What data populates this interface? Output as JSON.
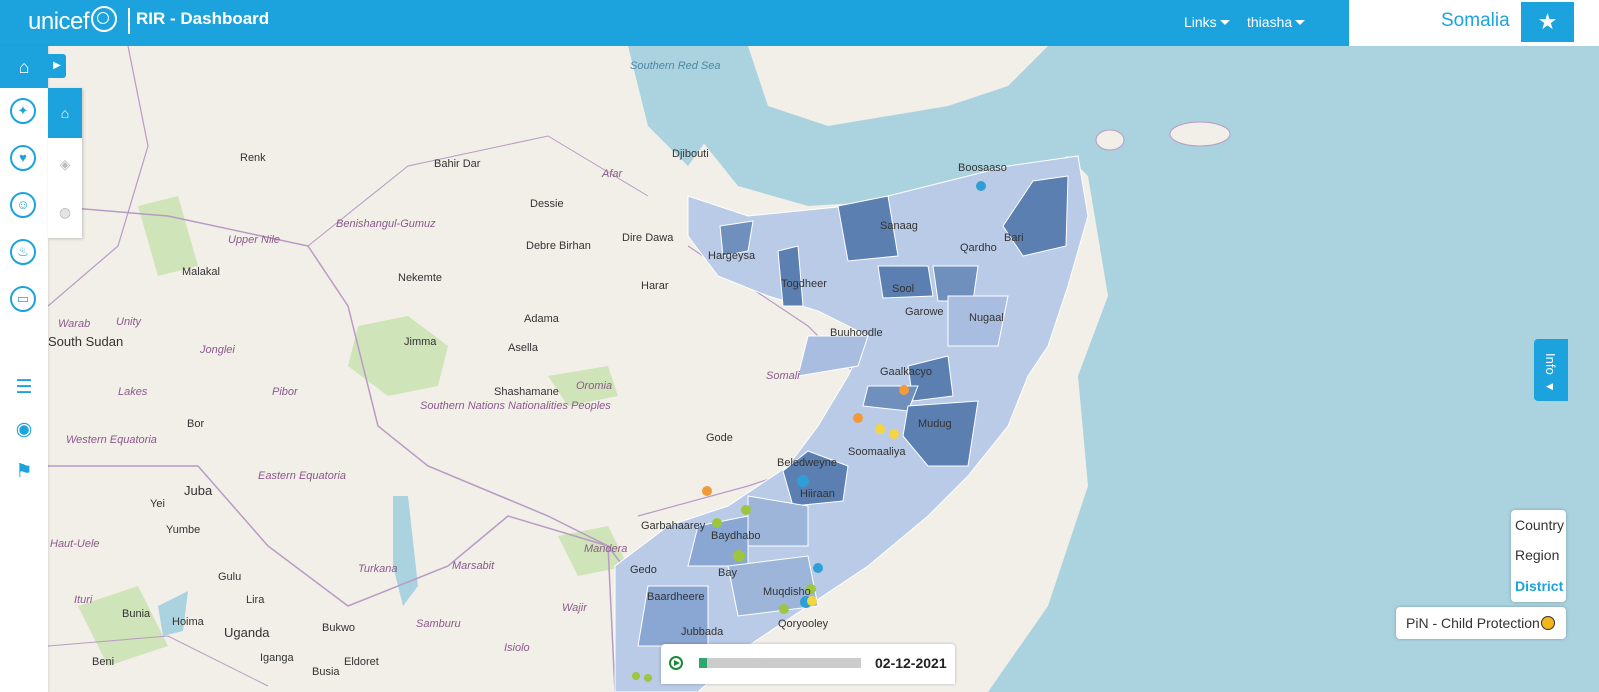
{
  "header": {
    "logo_text": "unicef",
    "app_title": "RIR - Dashboard",
    "links_label": "Links",
    "user_label": "thiasha",
    "country": "Somalia"
  },
  "colors": {
    "brand": "#1ca3dd",
    "choropleth_dark": "#5a7fb0",
    "choropleth_light": "#b9cbe6",
    "dot_orange": "#f29a3a",
    "dot_yellow": "#f5d442",
    "dot_green": "#9cc540",
    "dot_blue": "#2e9fd6"
  },
  "sidebar": {
    "icons": [
      "home-icon",
      "nutrition-icon",
      "protection-icon",
      "health-icon",
      "wash-icon",
      "education-icon",
      "list-icon",
      "globe-icon",
      "flag-icon"
    ]
  },
  "layer_panel": {
    "icons": [
      "home-icon",
      "layers-icon",
      "globe-icon"
    ]
  },
  "map": {
    "labels": [
      {
        "text": "Djibouti",
        "cls": "big"
      },
      {
        "text": "Hargeysa",
        "cls": "big"
      },
      {
        "text": "Boosaaso",
        "cls": ""
      },
      {
        "text": "Qardho",
        "cls": "region"
      },
      {
        "text": "Bari",
        "cls": "region"
      },
      {
        "text": "Sanaag",
        "cls": "region"
      },
      {
        "text": "Sool",
        "cls": "region"
      },
      {
        "text": "Togdheer",
        "cls": "region"
      },
      {
        "text": "Garowe",
        "cls": ""
      },
      {
        "text": "Nugaal",
        "cls": "region"
      },
      {
        "text": "Buuhoodle",
        "cls": ""
      },
      {
        "text": "Gaalkacyo",
        "cls": ""
      },
      {
        "text": "Mudug",
        "cls": "region"
      },
      {
        "text": "Soomaaliya",
        "cls": "big"
      },
      {
        "text": "Beledweyne",
        "cls": ""
      },
      {
        "text": "Hiiraan",
        "cls": "region"
      },
      {
        "text": "Garbahaarey",
        "cls": ""
      },
      {
        "text": "Baydhabo",
        "cls": ""
      },
      {
        "text": "Baardheere",
        "cls": ""
      },
      {
        "text": "Muqdisho",
        "cls": "big"
      },
      {
        "text": "Qoryooley",
        "cls": ""
      },
      {
        "text": "Gedo",
        "cls": "region"
      },
      {
        "text": "Bay",
        "cls": "region"
      },
      {
        "text": "Jubbada",
        "cls": "region"
      },
      {
        "text": "Dire Dawa",
        "cls": "big"
      },
      {
        "text": "Harar",
        "cls": ""
      },
      {
        "text": "Adama",
        "cls": ""
      },
      {
        "text": "Asella",
        "cls": ""
      },
      {
        "text": "Jimma",
        "cls": ""
      },
      {
        "text": "Shashamane",
        "cls": ""
      },
      {
        "text": "Gode",
        "cls": ""
      },
      {
        "text": "Bahir Dar",
        "cls": ""
      },
      {
        "text": "Dessie",
        "cls": ""
      },
      {
        "text": "Debre Birhan",
        "cls": ""
      },
      {
        "text": "Nekemte",
        "cls": ""
      },
      {
        "text": "Somali",
        "cls": "region"
      },
      {
        "text": "Oromia",
        "cls": "region"
      },
      {
        "text": "Southern Nations Nationalities Peoples",
        "cls": "region"
      },
      {
        "text": "Afar",
        "cls": "region"
      },
      {
        "text": "South Sudan",
        "cls": "big"
      },
      {
        "text": "Upper Nile",
        "cls": "region"
      },
      {
        "text": "Unity",
        "cls": "region"
      },
      {
        "text": "Warab",
        "cls": "region"
      },
      {
        "text": "Jonglei",
        "cls": "region"
      },
      {
        "text": "Lakes",
        "cls": "region"
      },
      {
        "text": "Pibor",
        "cls": "region"
      },
      {
        "text": "Western Equatoria",
        "cls": "region"
      },
      {
        "text": "Eastern Equatoria",
        "cls": "region"
      },
      {
        "text": "Juba",
        "cls": "big"
      },
      {
        "text": "Bor",
        "cls": ""
      },
      {
        "text": "Yei",
        "cls": ""
      },
      {
        "text": "Yumbe",
        "cls": ""
      },
      {
        "text": "Malakal",
        "cls": ""
      },
      {
        "text": "Renk",
        "cls": ""
      },
      {
        "text": "Turkana",
        "cls": "region"
      },
      {
        "text": "Marsabit",
        "cls": "region"
      },
      {
        "text": "Mandera",
        "cls": "region"
      },
      {
        "text": "Wajir",
        "cls": "region"
      },
      {
        "text": "Samburu",
        "cls": "region"
      },
      {
        "text": "Isiolo",
        "cls": "region"
      },
      {
        "text": "Uganda",
        "cls": "big"
      },
      {
        "text": "Bunia",
        "cls": ""
      },
      {
        "text": "Gulu",
        "cls": ""
      },
      {
        "text": "Lira",
        "cls": ""
      },
      {
        "text": "Hoima",
        "cls": ""
      },
      {
        "text": "Bukwo",
        "cls": ""
      },
      {
        "text": "Eldoret",
        "cls": ""
      },
      {
        "text": "Busia",
        "cls": ""
      },
      {
        "text": "Iganga",
        "cls": ""
      },
      {
        "text": "Beni",
        "cls": ""
      },
      {
        "text": "Haut-Uele",
        "cls": "region"
      },
      {
        "text": "Ituri",
        "cls": "region"
      },
      {
        "text": "Benishangul-Gumuz",
        "cls": "region"
      },
      {
        "text": "Southern Red Sea",
        "cls": "region"
      }
    ]
  },
  "info_tab": {
    "label": "Info"
  },
  "levels": {
    "items": [
      "Country",
      "Region",
      "District"
    ],
    "active": "District"
  },
  "legend": {
    "label": "PiN - Child Protection"
  },
  "timeline": {
    "date": "02-12-2021",
    "progress": 0.05
  }
}
